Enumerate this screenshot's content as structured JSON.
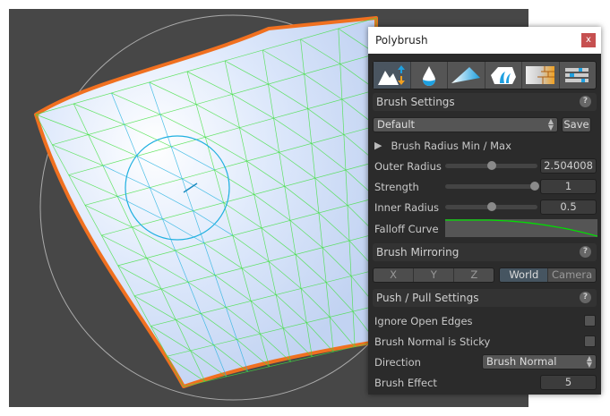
{
  "window": {
    "title": "Polybrush",
    "close_label": "x"
  },
  "toolbar": {
    "tools": [
      {
        "icon": "sculpt-icon",
        "active": true
      },
      {
        "icon": "smooth-icon"
      },
      {
        "icon": "paint-icon"
      },
      {
        "icon": "prefab-icon"
      },
      {
        "icon": "texture-icon"
      },
      {
        "icon": "settings-icon"
      }
    ]
  },
  "brush_settings": {
    "header": "Brush Settings",
    "preset": "Default",
    "save_label": "Save",
    "radius_toggle": "Brush Radius Min / Max",
    "outer_radius": {
      "label": "Outer Radius",
      "value": "2.504008",
      "slider": 0.5
    },
    "strength": {
      "label": "Strength",
      "value": "1",
      "slider": 1.0
    },
    "inner_radius": {
      "label": "Inner Radius",
      "value": "0.5",
      "slider": 0.5
    },
    "falloff_label": "Falloff Curve"
  },
  "mirroring": {
    "header": "Brush Mirroring",
    "axes": [
      "X",
      "Y",
      "Z"
    ],
    "spaces": [
      "World",
      "Camera"
    ],
    "selected_space": "World"
  },
  "push_pull": {
    "header": "Push / Pull Settings",
    "ignore_open_edges": "Ignore Open Edges",
    "normal_sticky": "Brush Normal is Sticky",
    "direction_label": "Direction",
    "direction_value": "Brush Normal",
    "effect_label": "Brush Effect",
    "effect_value": "5"
  },
  "colors": {
    "accent": "#f07820",
    "mesh_wire": "#40e040",
    "brush_wire": "#20b0e0",
    "curve": "#00e000"
  }
}
